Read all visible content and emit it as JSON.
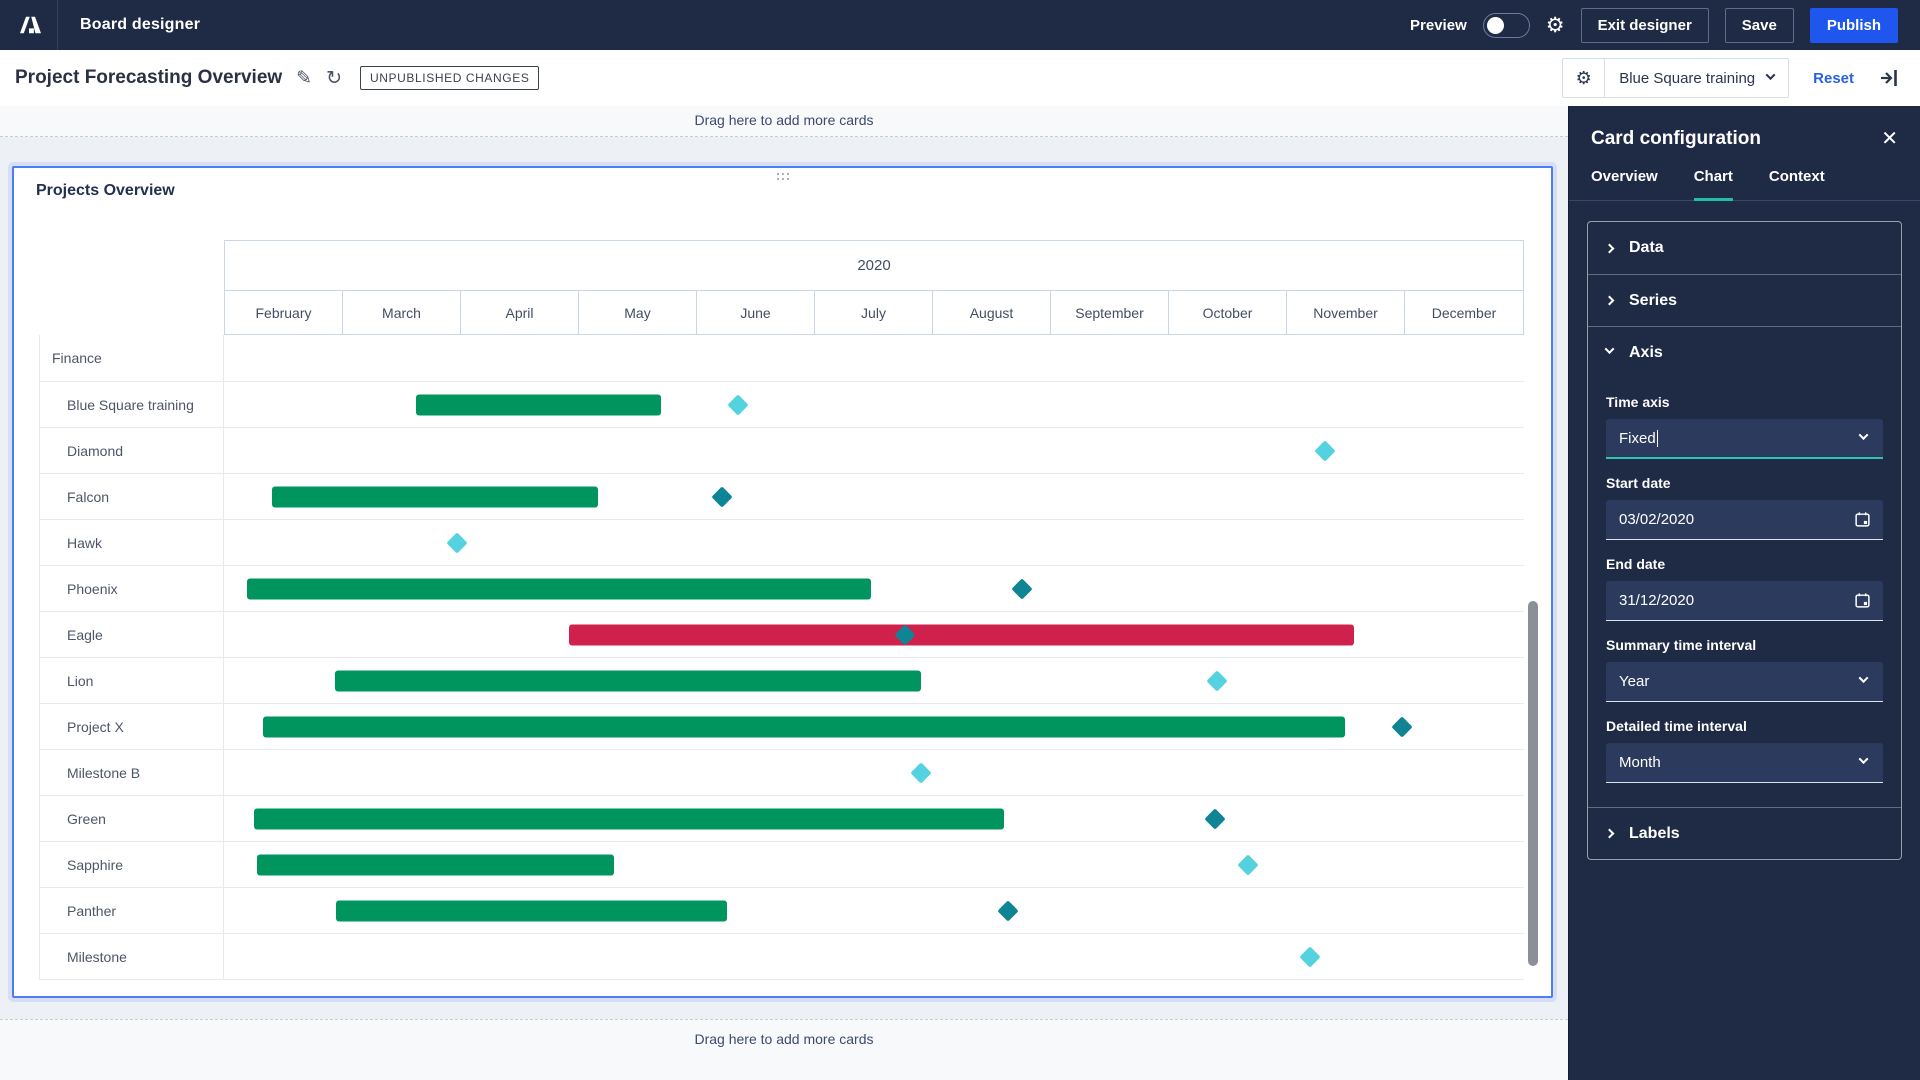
{
  "topbar": {
    "app_title": "Board designer",
    "preview_label": "Preview",
    "exit_designer_label": "Exit designer",
    "save_label": "Save",
    "publish_label": "Publish"
  },
  "toolbar": {
    "page_title": "Project Forecasting Overview",
    "unpublished_badge": "UNPUBLISHED CHANGES",
    "context_selector_value": "Blue Square training",
    "reset_label": "Reset"
  },
  "drop_zones": {
    "top_label": "Drag here to add more cards",
    "bottom_label": "Drag here to add more cards"
  },
  "card": {
    "title": "Projects Overview"
  },
  "panel": {
    "title": "Card configuration",
    "tabs": [
      {
        "label": "Overview",
        "active": false
      },
      {
        "label": "Chart",
        "active": true
      },
      {
        "label": "Context",
        "active": false
      }
    ],
    "sections": {
      "data": {
        "label": "Data",
        "expanded": false
      },
      "series": {
        "label": "Series",
        "expanded": false
      },
      "axis": {
        "label": "Axis",
        "expanded": true
      },
      "labels": {
        "label": "Labels",
        "expanded": false
      }
    },
    "axis_fields": {
      "time_axis": {
        "label": "Time axis",
        "value": "Fixed"
      },
      "start_date": {
        "label": "Start date",
        "value": "03/02/2020"
      },
      "end_date": {
        "label": "End date",
        "value": "31/12/2020"
      },
      "summary_interval": {
        "label": "Summary time interval",
        "value": "Year"
      },
      "detailed_interval": {
        "label": "Detailed time interval",
        "value": "Month"
      }
    }
  },
  "colors": {
    "topbar_navy": "#1F2A44",
    "accent_blue": "#1E56EE",
    "selection_blue": "#4D7CF6",
    "reset_blue": "#2961E3",
    "tab_teal": "#23BCA6",
    "focus_teal": "#2EC4B1",
    "bar_green": "#00945F",
    "bar_red": "#D0204C",
    "milestone_light": "#54D2E0",
    "milestone_dark": "#0F8494"
  },
  "chart_data": {
    "type": "gantt",
    "title": "Projects Overview",
    "year": "2020",
    "months": [
      "February",
      "March",
      "April",
      "May",
      "June",
      "July",
      "August",
      "September",
      "October",
      "November",
      "December"
    ],
    "timeline_note": "bar start/end and milestone positions are % of Feb-Dec 2020 timeline",
    "rows": [
      {
        "label": "Finance",
        "group": true
      },
      {
        "label": "Blue Square training",
        "bar": [
          14.8,
          33.6
        ],
        "bar_color": "#00945F",
        "milestone": 39.5,
        "milestone_color": "#54D2E0"
      },
      {
        "label": "Diamond",
        "milestone": 84.7,
        "milestone_color": "#54D2E0"
      },
      {
        "label": "Falcon",
        "bar": [
          3.7,
          28.8
        ],
        "bar_color": "#00945F",
        "milestone": 38.3,
        "milestone_color": "#0F8494"
      },
      {
        "label": "Hawk",
        "milestone": 17.9,
        "milestone_color": "#54D2E0"
      },
      {
        "label": "Phoenix",
        "bar": [
          1.8,
          49.8
        ],
        "bar_color": "#00945F",
        "milestone": 61.4,
        "milestone_color": "#0F8494"
      },
      {
        "label": "Eagle",
        "bar": [
          26.5,
          86.9
        ],
        "bar_color": "#D0204C",
        "milestone": 52.4,
        "milestone_color": "#0F8494"
      },
      {
        "label": "Lion",
        "bar": [
          8.5,
          53.6
        ],
        "bar_color": "#00945F",
        "milestone": 76.4,
        "milestone_color": "#54D2E0"
      },
      {
        "label": "Project X",
        "bar": [
          3.0,
          86.2
        ],
        "bar_color": "#00945F",
        "milestone": 90.6,
        "milestone_color": "#0F8494"
      },
      {
        "label": "Milestone B",
        "milestone": 53.6,
        "milestone_color": "#54D2E0"
      },
      {
        "label": "Green",
        "bar": [
          2.3,
          60.0
        ],
        "bar_color": "#00945F",
        "milestone": 76.2,
        "milestone_color": "#0F8494"
      },
      {
        "label": "Sapphire",
        "bar": [
          2.5,
          30.0
        ],
        "bar_color": "#00945F",
        "milestone": 78.8,
        "milestone_color": "#54D2E0"
      },
      {
        "label": "Panther",
        "bar": [
          8.6,
          38.7
        ],
        "bar_color": "#00945F",
        "milestone": 60.3,
        "milestone_color": "#0F8494"
      },
      {
        "label": "Milestone",
        "milestone": 83.5,
        "milestone_color": "#54D2E0"
      }
    ]
  }
}
